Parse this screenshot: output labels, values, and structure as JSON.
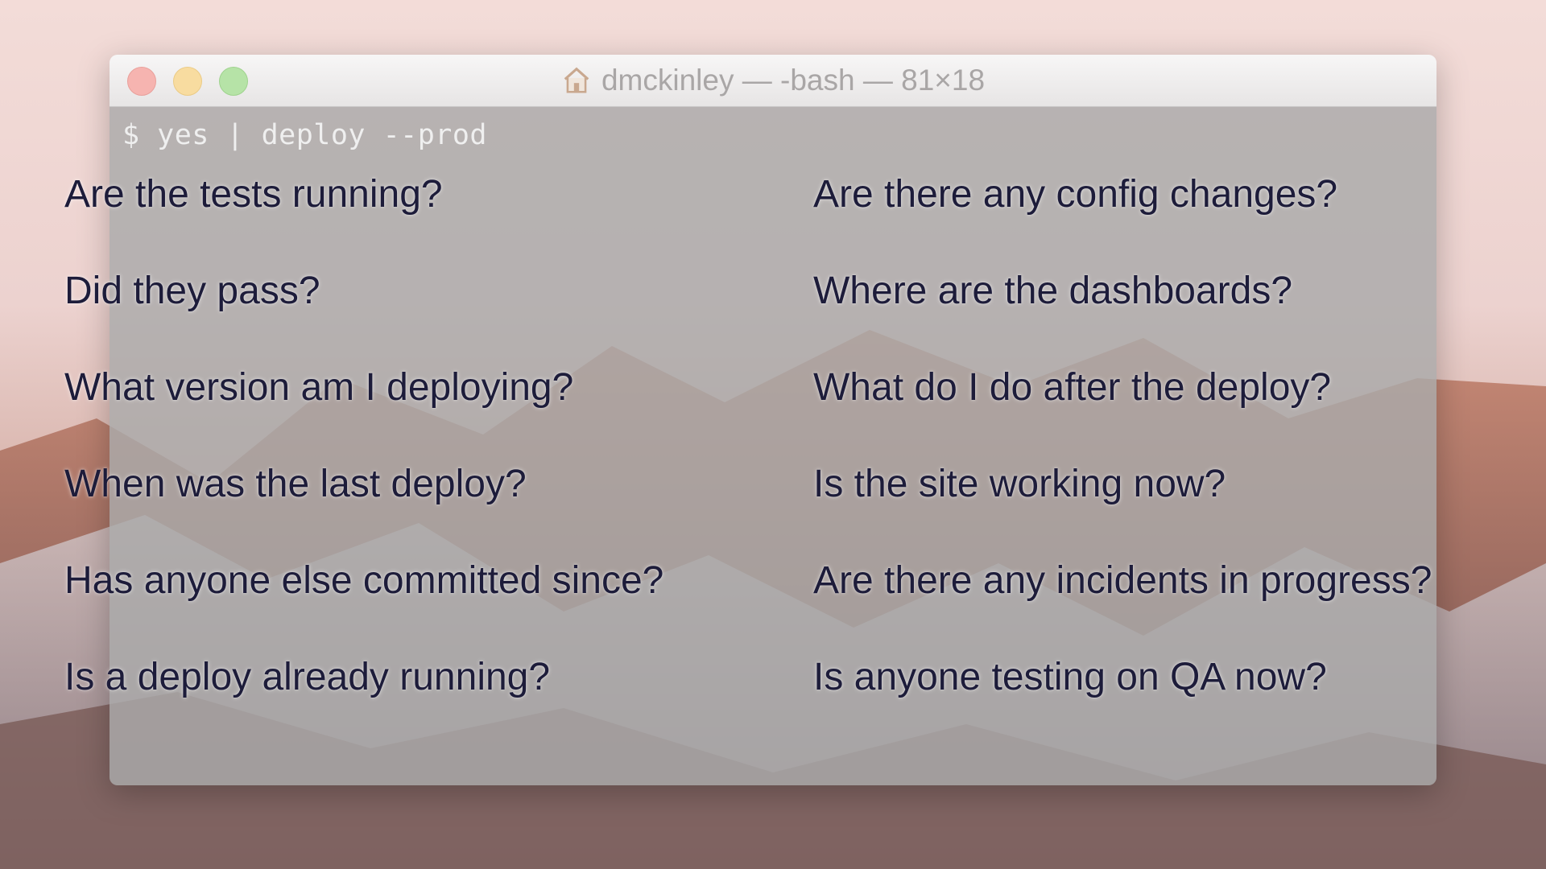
{
  "window": {
    "title": "dmckinley — -bash — 81×18",
    "title_icon": "home-icon"
  },
  "terminal": {
    "prompt_line": "$ yes | deploy --prod"
  },
  "questions": {
    "left": [
      "Are the tests running?",
      "Did they pass?",
      "What version am I deploying?",
      "When was the last deploy?",
      "Has anyone else committed since?",
      "Is a deploy already running?"
    ],
    "right": [
      "Are there any config changes?",
      "Where are the dashboards?",
      "What do I do after the deploy?",
      "Is the site working now?",
      "Are there any incidents in progress?",
      "Is anyone testing on QA now?"
    ]
  },
  "colors": {
    "close": "#f6b4b0",
    "minimize": "#f8dca0",
    "zoom": "#b6e3a7",
    "question_text": "#1d1c3a"
  }
}
